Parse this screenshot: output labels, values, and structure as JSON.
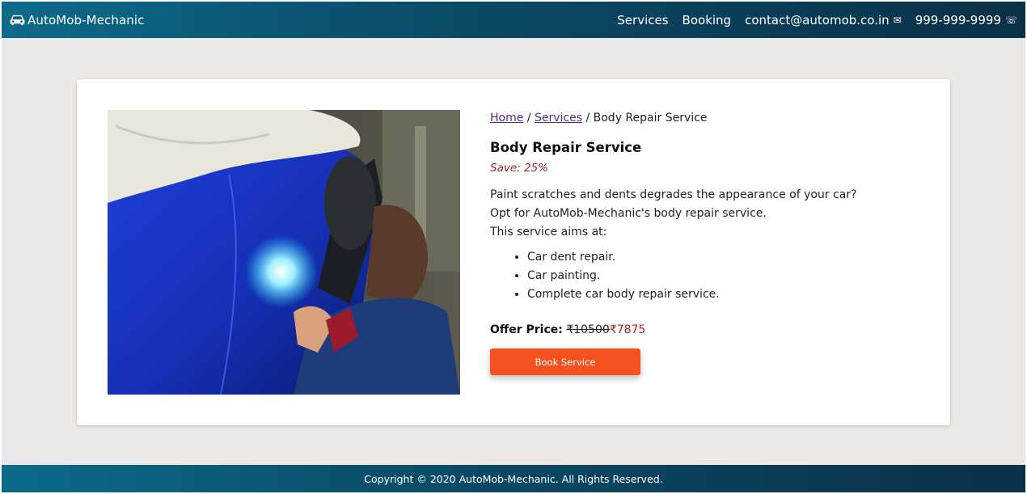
{
  "nav": {
    "brand": "AutoMob-Mechanic",
    "links": [
      {
        "label": "Services"
      },
      {
        "label": "Booking"
      },
      {
        "label": "contact@automob.co.in",
        "icon": "mail-icon",
        "glyph": "✉"
      },
      {
        "label": "999-999-9999",
        "icon": "phone-icon",
        "glyph": "☏"
      }
    ]
  },
  "breadcrumb": {
    "home": "Home",
    "sep1": " / ",
    "services": "Services",
    "sep2": " / ",
    "current": "Body Repair Service"
  },
  "service": {
    "title": "Body Repair Service",
    "save": "Save: 25%",
    "desc": [
      "Paint scratches and dents degrades the appearance of your car?",
      "Opt for AutoMob-Mechanic's body repair service.",
      "This service aims at:"
    ],
    "features": [
      "Car dent repair.",
      "Car painting.",
      "Complete car body repair service."
    ],
    "offer_label": "Offer Price:",
    "old_price": "₹10500",
    "new_price": "₹7875",
    "button": "Book Service"
  },
  "footer": {
    "copyright": "Copyright © 2020 AutoMob-Mechanic. All Rights Reserved."
  },
  "colors": {
    "nav_gradient_start": "#0c6a8a",
    "nav_gradient_end": "#0a3147",
    "button": "#f4511e",
    "price": "#b02323",
    "link": "#5b2b8c"
  }
}
